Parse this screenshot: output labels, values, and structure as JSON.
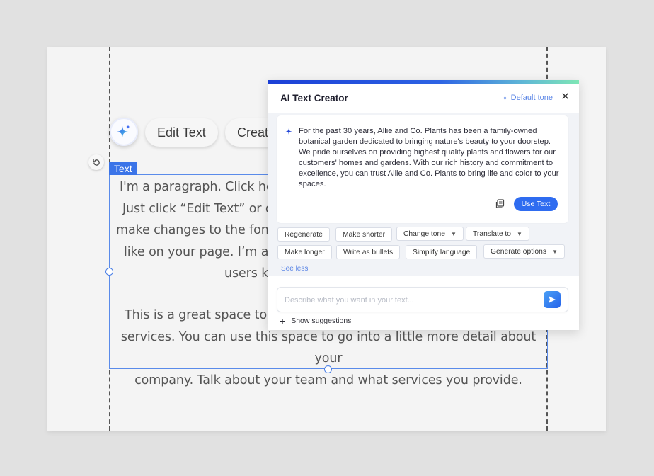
{
  "toolbar": {
    "ai_button_icon": "sparkle-icon",
    "edit_text_label": "Edit Text",
    "create_label": "Creat",
    "undo_icon": "rotate-ccw-icon"
  },
  "element": {
    "tag_label": "Text",
    "paragraph_lines": [
      "I'm a paragraph. Click he",
      "Just click “Edit Text” or d",
      "make changes to the font",
      "like on your page. I’m a",
      "users k"
    ],
    "paragraph2_lines": [
      "This is a great space to w",
      "services. You can use this space to go into a little more detail about your",
      "company. Talk about your team and what services you provide."
    ]
  },
  "panel": {
    "title": "AI Text Creator",
    "tone_label": "Default tone",
    "tone_icon": "sparkle-small-icon",
    "close_icon": "close-icon",
    "result_text": "For the past 30 years, Allie and Co. Plants has been a family-owned botanical garden dedicated to bringing nature's beauty to your doorstep. We pride ourselves on providing highest quality plants and flowers for our customers' homes and gardens. With our rich history and commitment to excellence, you can trust Allie and Co. Plants to bring life and color to your spaces.",
    "copy_icon": "copy-icon",
    "use_text_label": "Use Text",
    "chips": [
      {
        "label": "Regenerate",
        "dropdown": false
      },
      {
        "label": "Make shorter",
        "dropdown": false
      },
      {
        "label": "Change tone",
        "dropdown": true
      },
      {
        "label": "Translate to",
        "dropdown": true
      },
      {
        "label": "Make longer",
        "dropdown": false
      },
      {
        "label": "Write as bullets",
        "dropdown": false
      },
      {
        "label": "Simplify language",
        "dropdown": false
      },
      {
        "label": "Generate options",
        "dropdown": true
      }
    ],
    "see_less_label": "See less",
    "prompt_placeholder": "Describe what you want in your text...",
    "prompt_value": "",
    "send_icon": "send-icon",
    "show_suggestions_label": "Show suggestions"
  },
  "colors": {
    "accent": "#2f6cf0",
    "selection": "#3b74e8",
    "link": "#5a85e6"
  }
}
